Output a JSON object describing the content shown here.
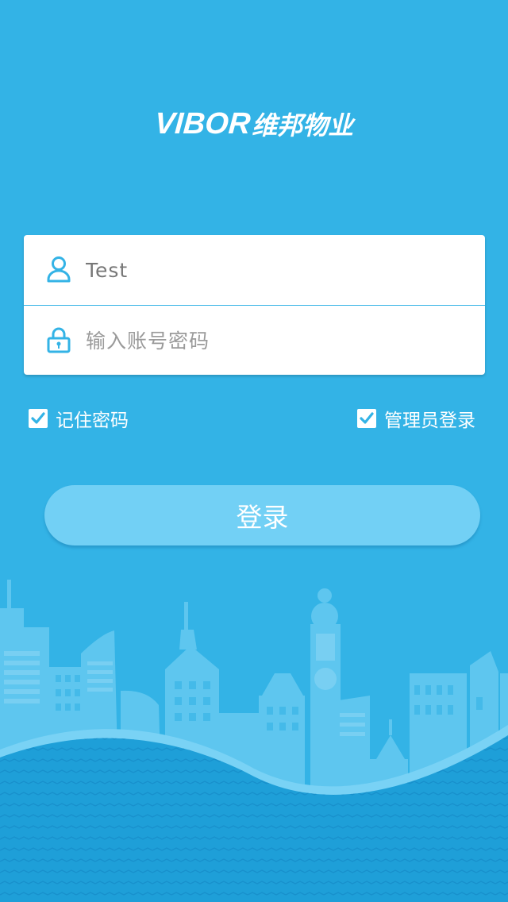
{
  "brand": {
    "name_latin": "VIBOR",
    "name_cjk": "维邦物业"
  },
  "login_form": {
    "username": {
      "value": "Test",
      "icon": "user-icon"
    },
    "password": {
      "placeholder": "输入账号密码",
      "icon": "lock-icon"
    }
  },
  "options": {
    "remember_password": {
      "label": "记住密码",
      "checked": true
    },
    "admin_login": {
      "label": "管理员登录",
      "checked": true
    }
  },
  "submit": {
    "label": "登录"
  },
  "colors": {
    "background": "#33b3e6",
    "button": "#72d0f5",
    "accent": "#33b3e6",
    "wave": "#1e9fd8"
  }
}
